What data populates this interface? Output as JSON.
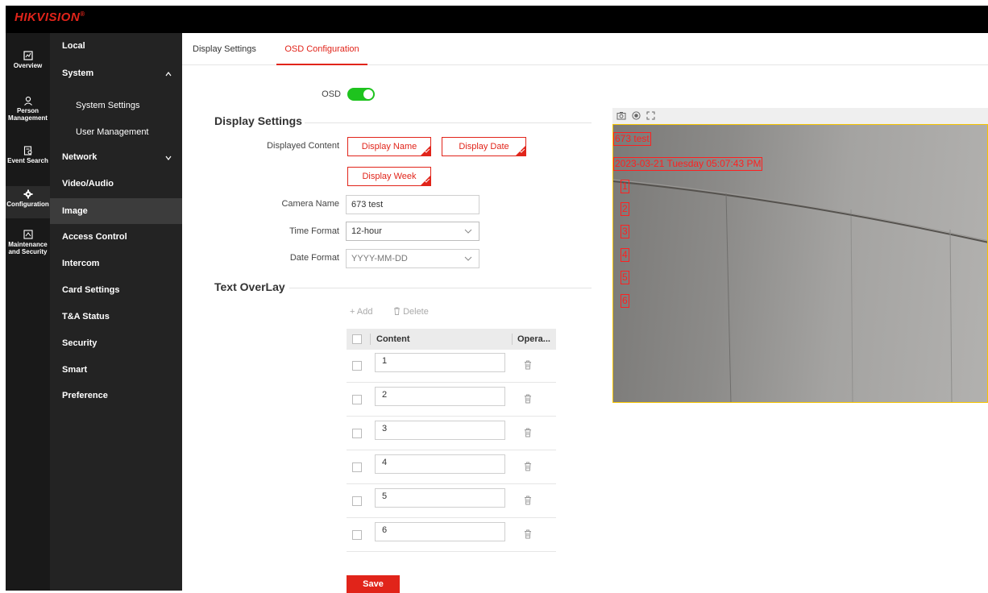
{
  "brand": {
    "logo_text": "HIKVISION",
    "mark": "®",
    "accent": "#e1241a"
  },
  "rail": [
    {
      "label": "Overview",
      "icon": "overview-icon"
    },
    {
      "label": "Person Management",
      "icon": "person-icon"
    },
    {
      "label": "Event Search",
      "icon": "event-search-icon"
    },
    {
      "label": "Configuration",
      "icon": "gear-icon",
      "active": true
    },
    {
      "label": "Maintenance and Security",
      "icon": "maintenance-icon"
    }
  ],
  "menu": {
    "local": "Local",
    "system": "System",
    "system_settings": "System Settings",
    "user_management": "User Management",
    "network": "Network",
    "video_audio": "Video/Audio",
    "image": "Image",
    "access_control": "Access Control",
    "intercom": "Intercom",
    "card_settings": "Card Settings",
    "ta_status": "T&A Status",
    "security": "Security",
    "smart": "Smart",
    "preference": "Preference"
  },
  "tabs": {
    "display_settings": "Display Settings",
    "osd_configuration": "OSD Configuration"
  },
  "osd": {
    "label": "OSD",
    "enabled": true
  },
  "display_settings": {
    "title": "Display Settings",
    "displayed_content_label": "Displayed Content",
    "chips": [
      "Display Name",
      "Display Date",
      "Display Week"
    ],
    "camera_name_label": "Camera Name",
    "camera_name_value": "673 test",
    "time_format_label": "Time Format",
    "time_format_value": "12-hour",
    "date_format_label": "Date Format",
    "date_format_value": "YYYY-MM-DD"
  },
  "text_overlay": {
    "title": "Text OverLay",
    "add_label": "+ Add",
    "delete_label": "Delete",
    "col_content": "Content",
    "col_operation": "Opera...",
    "rows": [
      "1",
      "2",
      "3",
      "4",
      "5",
      "6"
    ]
  },
  "save_label": "Save",
  "preview": {
    "osd_name": "673 test",
    "osd_datetime": "2023-03-21 Tuesday 05:07:43 PM",
    "overlay_items": [
      "1",
      "2",
      "3",
      "4",
      "5",
      "6"
    ],
    "osd_color": "#ff2020"
  }
}
